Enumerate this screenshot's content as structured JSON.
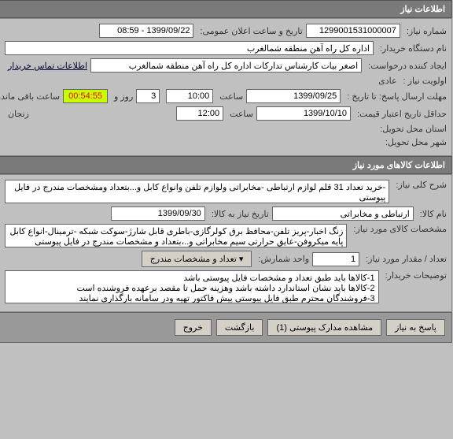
{
  "section1": {
    "title": "اطلاعات نیاز",
    "need_number_label": "شماره نیاز:",
    "need_number": "1299001531000007",
    "announce_label": "تاریخ و ساعت اعلان عمومی:",
    "announce_value": "1399/09/22 - 08:59",
    "buyer_org_label": "نام دستگاه خریدار:",
    "buyer_org": "اداره کل راه آهن منطقه شمالغرب",
    "creator_label": "ایجاد کننده درخواست:",
    "creator": "اصغر بیات کارشناس تدارکات اداره کل راه آهن منطقه شمالغرب",
    "contact_link": "اطلاعات تماس خریدار",
    "priority_label": "اولویت نیاز :",
    "priority": "عادی",
    "deadline_label": "مهلت ارسال پاسخ:  تا تاریخ :",
    "deadline_date": "1399/09/25",
    "time_label": "ساعت",
    "deadline_time": "10:00",
    "days_remain": "3",
    "days_suffix": "روز و",
    "countdown": "00:54:55",
    "remain_suffix": "ساعت باقی مانده",
    "validity_label": "حداقل تاریخ اعتبار قیمت:",
    "validity_date": "1399/10/10",
    "validity_time": "12:00",
    "zanjan_label": "زنجان",
    "delivery_province_label": "استان محل تحویل:",
    "delivery_city_label": "شهر محل تحویل:"
  },
  "section2": {
    "title": "اطلاعات کالاهای مورد نیاز",
    "desc_label": "شرح کلی نیاز:",
    "desc": "-خرید تعداد 31 قلم لوازم ارتباطی -مخابراتی ولوازم تلفن وانواع کابل و...بتعداد ومشخصات مندرج در فایل پیوستی",
    "goods_name_label": "نام کالا:",
    "goods_name": "ارتباطی و مخابراتی",
    "goods_date_label": "تاریخ نیاز به کالا:",
    "goods_date": "1399/09/30",
    "spec_label": "مشخصات کالای مورد نیاز:",
    "spec": "زنگ اخبار-پریز تلفن-محافظ برق کولرگازی-باطری قابل شارژ-سوکت شبکه -ترمینال-انواع کابل پایه میکروفن-عایق حرارتی سیم مخابراتی و..،بتعداد و مشخصات مندرج در فایل پیوستی",
    "qty_label": "تعداد / مقدار مورد نیاز:",
    "qty": "1",
    "unit_label": "واحد شمارش:",
    "unit_btn": "▾ تعداد و مشخصات مندرج",
    "notes_label": "توضیحات خریدار:",
    "notes": "1-کالاها باید طبق تعداد و مشخصات فایل پیوستی باشد\n2-کالاها باید نشان استاندارد داشته باشد وهزینه حمل تا مقصد برعهده فروشنده است\n3-فروشندگان محترم طبق فایل پیوستی پیش فاکتور تهیه ودر سامانه بارگذاری نمایند"
  },
  "buttons": {
    "respond": "پاسخ به نیاز",
    "view_attach": "مشاهده مدارک پیوستی (1)",
    "back": "بازگشت",
    "exit": "خروج"
  }
}
